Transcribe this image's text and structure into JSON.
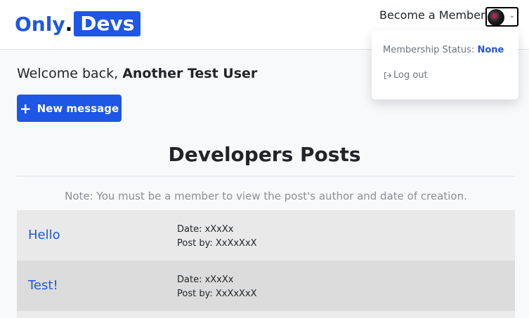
{
  "brand": {
    "only": "Only",
    "dot": ".",
    "devs": "Devs"
  },
  "nav": {
    "become_member": "Become a Member"
  },
  "dropdown": {
    "membership_label": "Membership Status:",
    "membership_value": "None",
    "logout_label": "Log out"
  },
  "welcome": {
    "prefix": "Welcome back,",
    "username": "Another Test User"
  },
  "actions": {
    "new_message": "New message"
  },
  "posts_section": {
    "title": "Developers Posts",
    "note": "Note: You must be a member to view the post's author and date of creation."
  },
  "posts": [
    {
      "title": "Hello",
      "date_label": "Date: xXxXx",
      "author_label": "Post by: XxXxXxX"
    },
    {
      "title": "Test!",
      "date_label": "Date: xXxXx",
      "author_label": "Post by: XxXxXxX"
    }
  ],
  "colors": {
    "brand_blue": "#1e56e6"
  },
  "icons": {
    "logout": "log-out-icon",
    "plus": "plus-icon",
    "caret": "chevron-down-icon"
  }
}
